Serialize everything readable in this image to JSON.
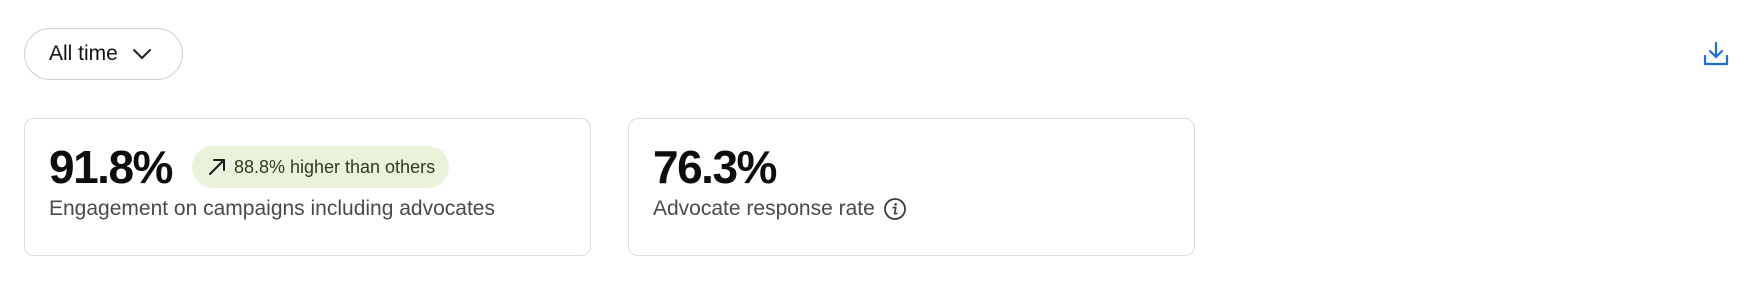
{
  "filter": {
    "label": "All time",
    "icon": "chevron-down-icon"
  },
  "toolbar": {
    "download_icon": "download-icon",
    "accent_color": "#1f6fd1"
  },
  "metrics": [
    {
      "value": "91.8%",
      "description": "Engagement on campaigns including advocates",
      "badge": {
        "text": "88.8% higher than others",
        "icon": "arrow-up-right-icon",
        "background": "#ebf2dc"
      }
    },
    {
      "value": "76.3%",
      "description": "Advocate response rate",
      "info_icon": "info-icon"
    }
  ]
}
